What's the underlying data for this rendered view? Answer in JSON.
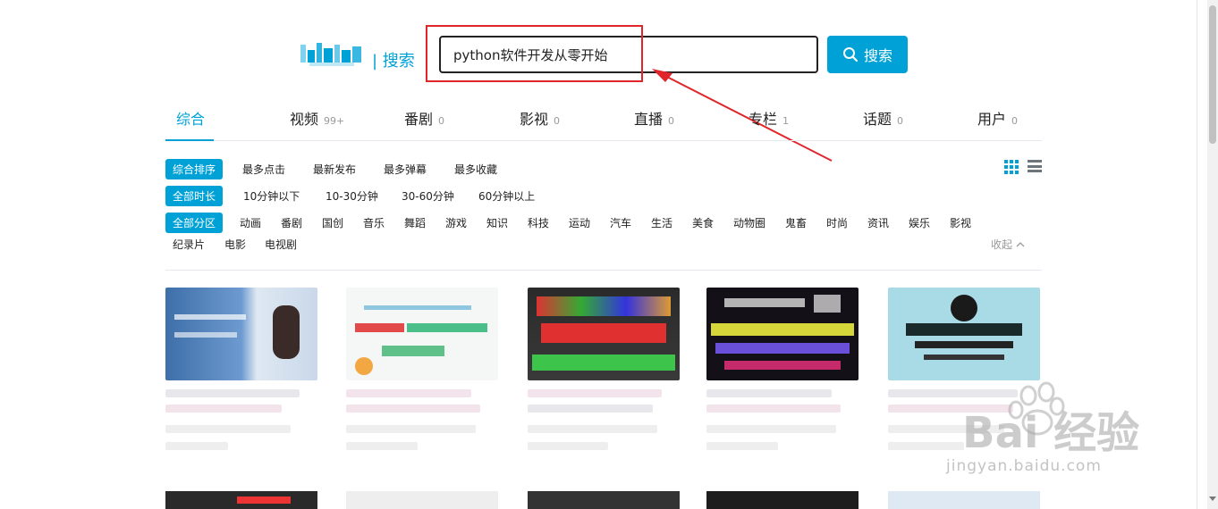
{
  "header": {
    "logo_suffix": "| 搜索",
    "search_value": "python软件开发从零开始",
    "search_button": "搜索"
  },
  "tabs": [
    {
      "label": "综合",
      "count": ""
    },
    {
      "label": "视频",
      "count": "99+"
    },
    {
      "label": "番剧",
      "count": "0"
    },
    {
      "label": "影视",
      "count": "0"
    },
    {
      "label": "直播",
      "count": "0"
    },
    {
      "label": "专栏",
      "count": "1"
    },
    {
      "label": "话题",
      "count": "0"
    },
    {
      "label": "用户",
      "count": "0"
    }
  ],
  "sort": {
    "active": "综合排序",
    "items": [
      "最多点击",
      "最新发布",
      "最多弹幕",
      "最多收藏"
    ]
  },
  "duration": {
    "active": "全部时长",
    "items": [
      "10分钟以下",
      "10-30分钟",
      "30-60分钟",
      "60分钟以上"
    ]
  },
  "zone": {
    "active": "全部分区",
    "items": [
      "动画",
      "番剧",
      "国创",
      "音乐",
      "舞蹈",
      "游戏",
      "知识",
      "科技",
      "运动",
      "汽车",
      "生活",
      "美食",
      "动物圈",
      "鬼畜",
      "时尚",
      "资讯",
      "娱乐",
      "影视"
    ],
    "items_row2": [
      "纪录片",
      "电影",
      "电视剧"
    ],
    "collapse_label": "收起"
  },
  "watermark": {
    "text": "Bai 经验",
    "sub": "jingyan.baidu.com"
  },
  "colors": {
    "accent": "#00a1d6",
    "annotation": "#e0262a"
  }
}
